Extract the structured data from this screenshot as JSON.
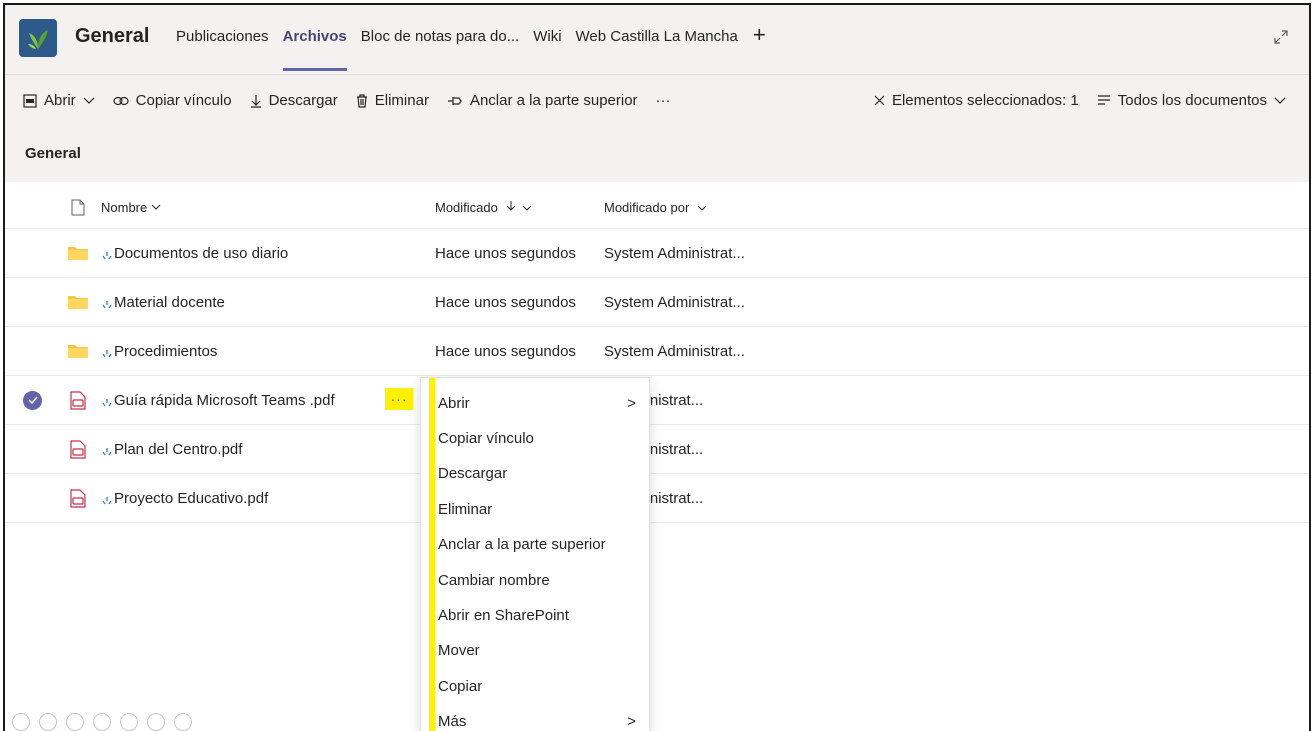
{
  "header": {
    "team_name": "General",
    "tabs": [
      {
        "label": "Publicaciones",
        "active": false
      },
      {
        "label": "Archivos",
        "active": true
      },
      {
        "label": "Bloc de notas para do...",
        "active": false
      },
      {
        "label": "Wiki",
        "active": false
      },
      {
        "label": "Web Castilla La Mancha",
        "active": false
      }
    ],
    "add_tab": "+"
  },
  "toolbar": {
    "open": "Abrir",
    "copy_link": "Copiar vínculo",
    "download": "Descargar",
    "delete": "Eliminar",
    "pin": "Anclar a la parte superior",
    "more": "···",
    "selected": "Elementos seleccionados: 1",
    "view": "Todos los documentos"
  },
  "section": {
    "title": "General"
  },
  "columns": {
    "name": "Nombre",
    "modified": "Modificado",
    "modified_by": "Modificado por"
  },
  "rows": [
    {
      "name": "Documentos de uso diario",
      "modified": "Hace unos segundos",
      "by": "System Administrat...",
      "type": "folder"
    },
    {
      "name": "Material docente",
      "modified": "Hace unos segundos",
      "by": "System Administrat...",
      "type": "folder"
    },
    {
      "name": "Procedimientos",
      "modified": "Hace unos segundos",
      "by": "System Administrat...",
      "type": "folder"
    },
    {
      "name": "Guía rápida Microsoft Teams .pdf",
      "modified": "",
      "by": "n Administrat...",
      "type": "pdf",
      "selected": true
    },
    {
      "name": "Plan del Centro.pdf",
      "modified": "",
      "by": "n Administrat...",
      "type": "pdf"
    },
    {
      "name": "Proyecto Educativo.pdf",
      "modified": "",
      "by": "n Administrat...",
      "type": "pdf"
    }
  ],
  "row_more": "···",
  "context_menu": {
    "items": [
      {
        "label": "Abrir",
        "submenu": ">"
      },
      {
        "label": "Copiar vínculo"
      },
      {
        "label": "Descargar"
      },
      {
        "label": "Eliminar"
      },
      {
        "label": "Anclar a la parte superior"
      },
      {
        "label": "Cambiar nombre"
      },
      {
        "label": "Abrir en SharePoint"
      },
      {
        "label": "Mover"
      },
      {
        "label": "Copiar"
      },
      {
        "label": "Más",
        "submenu": ">"
      }
    ]
  },
  "colors": {
    "accent": "#6264a7",
    "highlight": "#fff100",
    "folder": "#f3c548",
    "pdf": "#c4314b"
  }
}
